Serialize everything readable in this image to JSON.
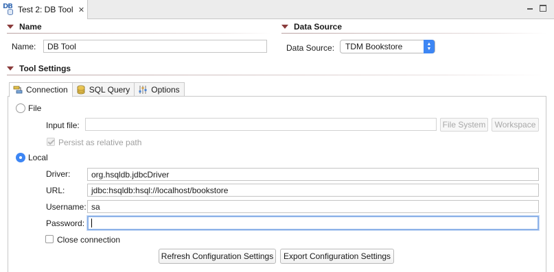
{
  "editor": {
    "tab_title": "Test 2: DB Tool",
    "icon_text": "DB"
  },
  "name_section": {
    "header": "Name",
    "name_label": "Name:",
    "name_value": "DB Tool"
  },
  "data_source_section": {
    "header": "Data Source",
    "label": "Data Source:",
    "selected": "TDM Bookstore"
  },
  "tool_settings": {
    "header": "Tool Settings",
    "tabs": [
      {
        "label": "Connection",
        "icon": "connection-icon",
        "active": true
      },
      {
        "label": "SQL Query",
        "icon": "database-icon",
        "active": false
      },
      {
        "label": "Options",
        "icon": "options-icon",
        "active": false
      }
    ]
  },
  "connection": {
    "file_radio_label": "File",
    "input_file_label": "Input file:",
    "input_file_value": "",
    "file_system_button": "File System",
    "workspace_button": "Workspace",
    "persist_label": "Persist as relative path",
    "local_radio_label": "Local",
    "driver_label": "Driver:",
    "driver_value": "org.hsqldb.jdbcDriver",
    "url_label": "URL:",
    "url_value": "jdbc:hsqldb:hsql://localhost/bookstore",
    "username_label": "Username:",
    "username_value": "sa",
    "password_label": "Password:",
    "password_value": "",
    "close_connection_label": "Close connection",
    "refresh_button": "Refresh Configuration Settings",
    "export_button": "Export Configuration Settings"
  },
  "colors": {
    "accent": "#3d86f4",
    "section_triangle": "#8a3b3b",
    "focus_ring": "#8db2e8"
  }
}
